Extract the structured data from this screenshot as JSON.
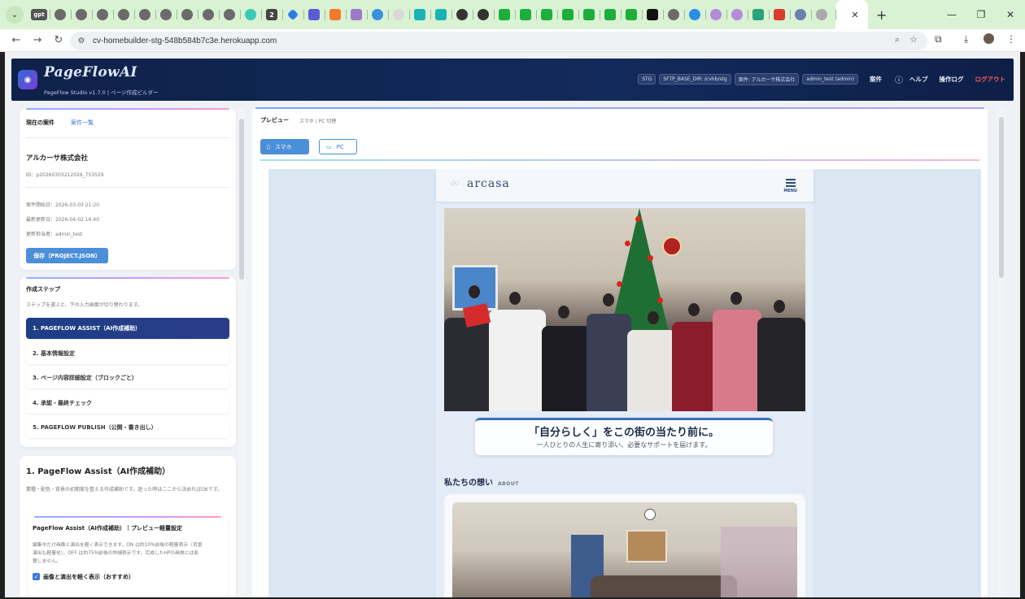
{
  "browser": {
    "tab_active_label": "",
    "tab_count_badge": "2",
    "tab_gpt_label": "gpt",
    "url": "cv-homebuilder-stg-548b584b7c3e.herokuapp.com"
  },
  "header": {
    "brand": "PageFlowAI",
    "subtitle": "PageFlow Studio v1.7.0 | ページ作成ビルダー",
    "pills": [
      "STG",
      "SFTP_BASE_DIR: /cvhb/stg",
      "案件: アルカーサ株式会社",
      "admin_test (admin)"
    ],
    "links": {
      "projects": "案件",
      "help": "ヘルプ",
      "oplog": "操作ログ",
      "logout": "ログアウト"
    }
  },
  "project": {
    "current_label": "現在の案件",
    "list_link": "案件一覧",
    "name": "アルカーサ株式会社",
    "id_text": "ID：p20260303212026_753529",
    "start_date": "案件開始日：2026-03-03 21:20",
    "updated": "最新更新日：2026-04-02 16:40",
    "updater": "更新担当者：admin_test",
    "save_button": "保存（PROJECT.JSON）"
  },
  "steps": {
    "title": "作成ステップ",
    "hint": "ステップを選ぶと、下の入力画面が切り替わります。",
    "items": [
      "1. PAGEFLOW ASSIST（AI作成補助）",
      "2. 基本情報設定",
      "3. ページ内容詳細設定（ブロックごと）",
      "4. 承認・最終チェック",
      "5. PAGEFLOW PUBLISH（公開・書き出し）"
    ]
  },
  "assist": {
    "title": "1. PageFlow Assist（AI作成補助）",
    "desc": "業種・配色・背景の初期案を整える作成補助です。迷った時はここから決めればOKです。",
    "card_title": "PageFlow Assist（AI作成補助）｜プレビュー軽量設定",
    "card_desc_1": "編集中だけ画像と演出を軽く表示できます。ON は約10%前後の軽量表示（背景",
    "card_desc_2": "演出も軽量化）、OFF は約75%前後の詳細表示です。完成したHPの画質には影",
    "card_desc_3": "響しません。",
    "checkbox_label": "画像と演出を軽く表示（おすすめ）"
  },
  "preview": {
    "title": "プレビュー",
    "subtitle": "スマホ / PC 切替",
    "mode_sp": "スマホ",
    "mode_pc": "PC",
    "site_logo": "arcasa",
    "menu_label": "MENU",
    "hero_title": "「自分らしく」をこの街の当たり前に。",
    "hero_sub": "一人ひとりの人生に寄り添い、必要なサポートを届けます。",
    "about_title": "私たちの想い",
    "about_en": "ABOUT"
  }
}
